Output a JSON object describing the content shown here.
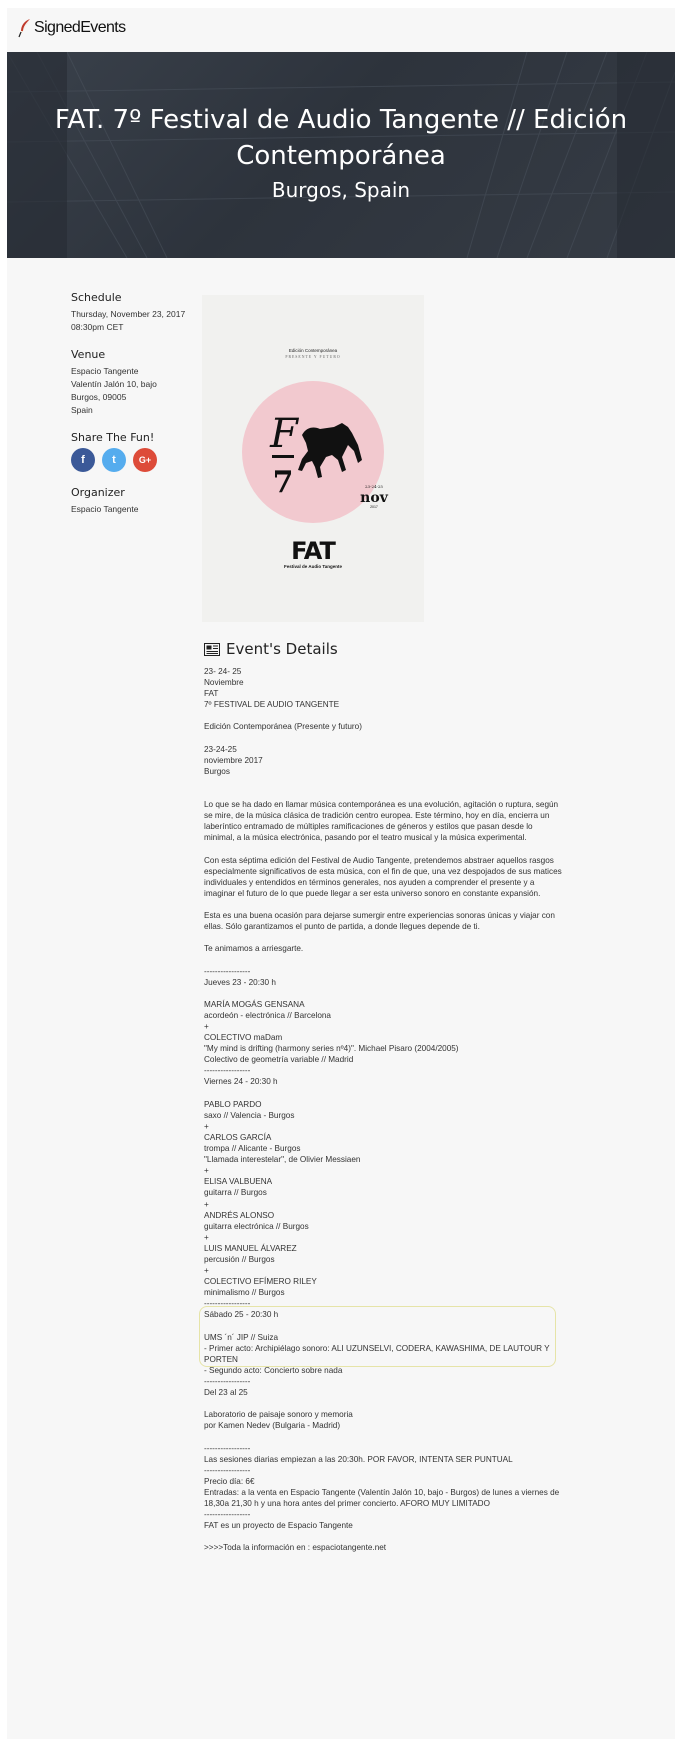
{
  "brand": {
    "name": "SignedEvents"
  },
  "hero": {
    "title": "FAT. 7º Festival de Audio Tangente // Edición Contemporánea",
    "location": "Burgos, Spain"
  },
  "sidebar": {
    "schedule": {
      "heading": "Schedule",
      "date": "Thursday, November 23, 2017",
      "time": "08:30pm CET"
    },
    "venue": {
      "heading": "Venue",
      "lines": [
        "Espacio Tangente",
        "Valentín Jalón 10, bajo",
        "Burgos, 09005",
        "Spain"
      ]
    },
    "share": {
      "heading": "Share The Fun!",
      "facebook": "f",
      "twitter": "t",
      "google": "G+"
    },
    "organizer": {
      "heading": "Organizer",
      "name": "Espacio Tangente"
    }
  },
  "poster": {
    "top_line": "Edición Contemporánea",
    "top_sub": "PRESENTE Y FUTURO",
    "big_letter": "F",
    "number": "7",
    "month": "nov",
    "dates": "23-24-25",
    "year": "2017",
    "logo": "FAT",
    "caption": "Festival de Audio Tangente"
  },
  "details": {
    "heading": "Event's Details",
    "lines": [
      "23- 24- 25",
      "Noviembre",
      "FAT",
      "7º FESTIVAL DE AUDIO TANGENTE",
      "",
      "Edición Contemporánea (Presente y futuro)",
      "",
      "23-24-25",
      "noviembre 2017",
      "Burgos",
      "",
      "",
      "Lo que se ha dado en llamar música contemporánea es una evolución, agitación o ruptura, según se mire, de la música clásica de tradición centro europea. Este término, hoy en día, encierra un laberíntico entramado de múltiples ramificaciones de géneros y estilos que pasan desde lo minimal, a la música electrónica, pasando por el teatro musical y la música experimental.",
      "",
      "Con esta séptima edición del Festival de Audio Tangente, pretendemos abstraer aquellos rasgos especialmente significativos de esta música, con el fin de que, una vez despojados de sus matices individuales y entendidos en términos generales, nos ayuden a comprender el presente y a imaginar el futuro de lo que puede llegar a ser esta universo sonoro en constante expansión.",
      "",
      "Esta es una buena ocasión para dejarse sumergir entre experiencias sonoras únicas y viajar con ellas. Sólo garantizamos el punto de partida, a donde llegues depende de ti.",
      "",
      "Te animamos a arriesgarte.",
      "",
      "-----------------",
      "Jueves 23 - 20:30 h",
      "",
      "MARÍA MOGÁS GENSANA",
      "acordeón - electrónica // Barcelona",
      "+",
      "COLECTIVO maDam",
      "\"My mind is drifting (harmony series nº4)\". Michael Pisaro (2004/2005)",
      "Colectivo de geometría variable // Madrid",
      "-----------------",
      "Viernes 24 - 20:30 h",
      "",
      "PABLO PARDO",
      "saxo // Valencia - Burgos",
      "+",
      "CARLOS GARCÍA",
      "trompa // Alicante - Burgos",
      "\"Llamada interestelar\", de Olivier Messiaen",
      "+",
      "ELISA VALBUENA",
      "guitarra // Burgos",
      "+",
      "ANDRÉS ALONSO",
      "guitarra electrónica // Burgos",
      "+",
      "LUIS MANUEL ÁLVAREZ",
      "percusión // Burgos",
      "+",
      "COLECTIVO EFÍMERO RILEY",
      "minimalismo // Burgos",
      "-----------------",
      "Sábado 25 - 20:30 h",
      "",
      "UMS ´n´ JIP // Suiza",
      "- Primer acto: Archipiélago sonoro: ALI UZUNSELVI, CODERA, KAWASHIMA, DE LAUTOUR Y PORTEN",
      "- Segundo acto: Concierto sobre nada",
      "-----------------",
      "Del 23 al 25",
      "",
      "Laboratorio de paisaje sonoro y memoria",
      "por Kamen Nedev (Bulgaria - Madrid)",
      "",
      "-----------------",
      "Las sesiones diarias empiezan a las 20:30h. POR FAVOR, INTENTA SER PUNTUAL",
      "-----------------",
      "Precio día: 6€",
      "Entradas: a la venta en Espacio Tangente (Valentín Jalón 10, bajo - Burgos) de lunes a viernes de 18,30a 21,30 h y una hora antes del primer concierto. AFORO MUY LIMITADO",
      "-----------------",
      "FAT es un proyecto de Espacio Tangente",
      "",
      ">>>>Toda la información en : espaciotangente.net"
    ]
  },
  "colors": {
    "hero_bg": "#30363f",
    "poster_circle": "#f2c9cf",
    "facebook": "#3b5998",
    "twitter": "#55acee",
    "google": "#dd4b39"
  }
}
